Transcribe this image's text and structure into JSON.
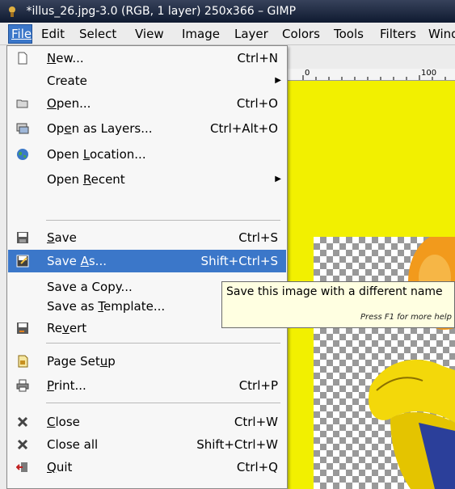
{
  "window": {
    "title": "*illus_26.jpg-3.0 (RGB, 1 layer) 250x366 – GIMP"
  },
  "menubar": {
    "items": [
      {
        "label": "File"
      },
      {
        "label": "Edit"
      },
      {
        "label": "Select"
      },
      {
        "label": "View"
      },
      {
        "label": "Image"
      },
      {
        "label": "Layer"
      },
      {
        "label": "Colors"
      },
      {
        "label": "Tools"
      },
      {
        "label": "Filters"
      },
      {
        "label": "Wind"
      }
    ]
  },
  "ruler": {
    "labels": [
      "0",
      "100"
    ]
  },
  "file_menu": {
    "items": [
      {
        "label": "New...",
        "shortcut": "Ctrl+N",
        "icon": "new-file-icon"
      },
      {
        "label": "Create",
        "shortcut": "",
        "submenu": true
      },
      {
        "label": "Open...",
        "shortcut": "Ctrl+O",
        "icon": "open-folder-icon"
      },
      {
        "label": "Open as Layers...",
        "shortcut": "Ctrl+Alt+O",
        "icon": "open-layers-icon"
      },
      {
        "label": "Open Location...",
        "shortcut": "",
        "icon": "globe-icon"
      },
      {
        "label": "Open Recent",
        "shortcut": "",
        "submenu": true
      },
      {
        "label": "Save",
        "shortcut": "Ctrl+S",
        "icon": "save-icon"
      },
      {
        "label": "Save As...",
        "shortcut": "Shift+Ctrl+S",
        "icon": "save-as-icon",
        "highlighted": true
      },
      {
        "label": "Save a Copy...",
        "shortcut": ""
      },
      {
        "label": "Save as Template...",
        "shortcut": ""
      },
      {
        "label": "Revert",
        "shortcut": "",
        "icon": "revert-icon"
      },
      {
        "label": "Page Setup",
        "shortcut": "",
        "icon": "page-setup-icon"
      },
      {
        "label": "Print...",
        "shortcut": "Ctrl+P",
        "icon": "printer-icon"
      },
      {
        "label": "Close",
        "shortcut": "Ctrl+W",
        "icon": "close-icon"
      },
      {
        "label": "Close all",
        "shortcut": "Shift+Ctrl+W",
        "icon": "close-all-icon"
      },
      {
        "label": "Quit",
        "shortcut": "Ctrl+Q",
        "icon": "quit-icon"
      }
    ]
  },
  "tooltip": {
    "text": "Save this image with a different name",
    "help": "Press F1 for more help"
  },
  "colors": {
    "highlight": "#3b77c9",
    "canvas": "#f2f000",
    "tooltip_bg": "#ffffe1"
  }
}
